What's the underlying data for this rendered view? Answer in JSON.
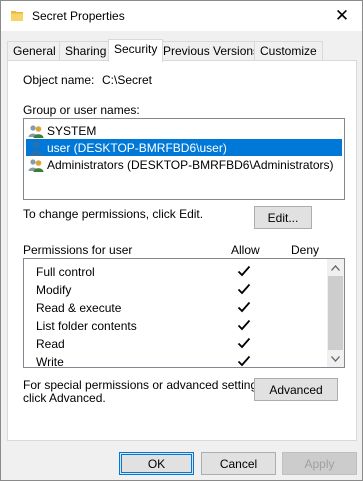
{
  "window": {
    "title": "Secret Properties",
    "close_glyph": "✕"
  },
  "tabs": [
    {
      "label": "General"
    },
    {
      "label": "Sharing"
    },
    {
      "label": "Security",
      "active": true
    },
    {
      "label": "Previous Versions"
    },
    {
      "label": "Customize"
    }
  ],
  "security": {
    "object_name_label": "Object name:",
    "object_name_value": "C:\\Secret",
    "groups_label": "Group or user names:",
    "groups": [
      {
        "name": "SYSTEM",
        "icon": "group-icon",
        "selected": false
      },
      {
        "name": "user (DESKTOP-BMRFBD6\\user)",
        "icon": "user-icon",
        "selected": true
      },
      {
        "name": "Administrators (DESKTOP-BMRFBD6\\Administrators)",
        "icon": "group-icon",
        "selected": false
      }
    ],
    "change_hint": "To change permissions, click Edit.",
    "edit_button": "Edit...",
    "permissions_label": "Permissions for user",
    "allow_header": "Allow",
    "deny_header": "Deny",
    "permissions": [
      {
        "name": "Full control",
        "allow": true,
        "deny": false
      },
      {
        "name": "Modify",
        "allow": true,
        "deny": false
      },
      {
        "name": "Read & execute",
        "allow": true,
        "deny": false
      },
      {
        "name": "List folder contents",
        "allow": true,
        "deny": false
      },
      {
        "name": "Read",
        "allow": true,
        "deny": false
      },
      {
        "name": "Write",
        "allow": true,
        "deny": false
      }
    ],
    "advanced_hint_line1": "For special permissions or advanced settings,",
    "advanced_hint_line2": "click Advanced.",
    "advanced_button": "Advanced"
  },
  "footer": {
    "ok": "OK",
    "cancel": "Cancel",
    "apply": "Apply"
  },
  "colors": {
    "selection": "#0078d7",
    "accent": "#0078d7"
  }
}
